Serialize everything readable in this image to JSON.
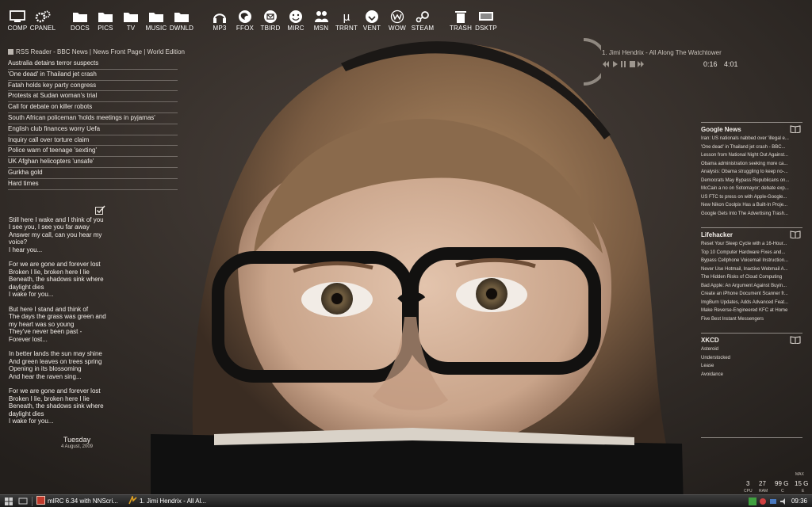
{
  "dock": [
    {
      "label": "COMP",
      "icon": "computer-icon"
    },
    {
      "label": "CPANEL",
      "icon": "gears-icon"
    },
    {
      "label": "DOCS",
      "icon": "folder-icon"
    },
    {
      "label": "PICS",
      "icon": "folder-icon"
    },
    {
      "label": "TV",
      "icon": "folder-icon"
    },
    {
      "label": "MUSIC",
      "icon": "folder-icon"
    },
    {
      "label": "DWNLD",
      "icon": "folder-icon"
    },
    {
      "label": "MP3",
      "icon": "headphones-icon"
    },
    {
      "label": "FFOX",
      "icon": "firefox-icon"
    },
    {
      "label": "TBIRD",
      "icon": "thunderbird-icon"
    },
    {
      "label": "MIRC",
      "icon": "mirc-icon"
    },
    {
      "label": "MSN",
      "icon": "msn-icon"
    },
    {
      "label": "TRRNT",
      "icon": "utorrent-icon"
    },
    {
      "label": "VENT",
      "icon": "ventrilo-icon"
    },
    {
      "label": "WOW",
      "icon": "wow-icon"
    },
    {
      "label": "STEAM",
      "icon": "steam-icon"
    },
    {
      "label": "TRASH",
      "icon": "trash-icon"
    },
    {
      "label": "DSKTP",
      "icon": "desktop-icon"
    }
  ],
  "rss": {
    "header": "RSS Reader - BBC News | News Front Page | World Edition",
    "items": [
      "Australia detains terror suspects",
      "'One dead' in Thailand jet crash",
      "Fatah holds key party congress",
      "Protests at Sudan woman's trial",
      "Call for debate on killer robots",
      "South African policeman 'holds meetings in pyjamas'",
      "English club finances worry Uefa",
      "Inquiry call over torture claim",
      "Police warn of teenage 'sexting'",
      "UK Afghan helicopters 'unsafe'",
      "Gurkha gold",
      "Hard times"
    ]
  },
  "lyrics": "Still here I wake and I think of you\nI see you, I see you far away\nAnswer my call, can you hear my voice?\nI hear you...\n\nFor we are gone and forever lost\nBroken I lie, broken here I lie\nBeneath, the shadows sink where daylight dies\nI wake for you...\n\nBut here I stand and think of\nThe days the grass was green and my heart was so young\nThey've never been past -\nForever lost...\n\nIn better lands the sun may shine\nAnd green leaves on trees spring\nOpening in its blossoming\nAnd hear the raven sing...\n\nFor we are gone and forever lost\nBroken I lie, broken here I lie\nBeneath, the shadows sink where daylight dies\nI wake for you...",
  "date": {
    "day": "Tuesday",
    "date": "4 August, 2009"
  },
  "now_playing": {
    "title": "1. Jimi Hendrix - All Along The Watchtower",
    "elapsed": "0:16",
    "total": "4:01"
  },
  "feeds": [
    {
      "title": "Google News",
      "items": [
        "Iran: US nationals nabbed over 'illegal e...",
        "'One dead' in Thailand jet crash - BBC...",
        "Lesson from National Night Out Against...",
        "Obama administration seeking more ca...",
        "Analysis: Obama struggling to keep no-...",
        "Democrats May Bypass Republicans on...",
        "McCain a no on Sotomayor; debate exp...",
        "US FTC to press on with Apple-Google...",
        "New Nikon Coolpix Has a Built-In Proje...",
        "Google Gets Into The Advertising Trash..."
      ]
    },
    {
      "title": "Lifehacker",
      "items": [
        "Reset Your Sleep Cycle with a 16-Hour...",
        "Top 10 Computer Hardware Fixes and...",
        "Bypass Cellphone Voicemail Instruction...",
        "Never Use Hotmail, Inactive Webmail A...",
        "The Hidden Risks of Cloud Computing",
        "Bad Apple: An Argument Against Buyin...",
        "Create an iPhone Document Scanner fr...",
        "ImgBurn Updates, Adds Advanced Feat...",
        "Make Reverse-Engineered KFC at Home",
        "Five Best Instant Messengers"
      ]
    },
    {
      "title": "XKCD",
      "items": [
        "Asteroid",
        "Understocked",
        "Lease",
        "Avoidance"
      ]
    }
  ],
  "stats": [
    {
      "value": "3",
      "label": "CPU"
    },
    {
      "value": "27",
      "label": "RAM"
    },
    {
      "value": "99 G",
      "label": "C"
    },
    {
      "value": "15 G",
      "label": "E"
    }
  ],
  "stats_max": "MAX",
  "taskbar": {
    "tasks": [
      {
        "label": "mIRC 6.34 with NNScri...",
        "icon": "mirc-task-icon"
      },
      {
        "label": "1. Jimi Hendrix - All Al...",
        "icon": "winamp-task-icon"
      }
    ],
    "clock": "09:36"
  }
}
